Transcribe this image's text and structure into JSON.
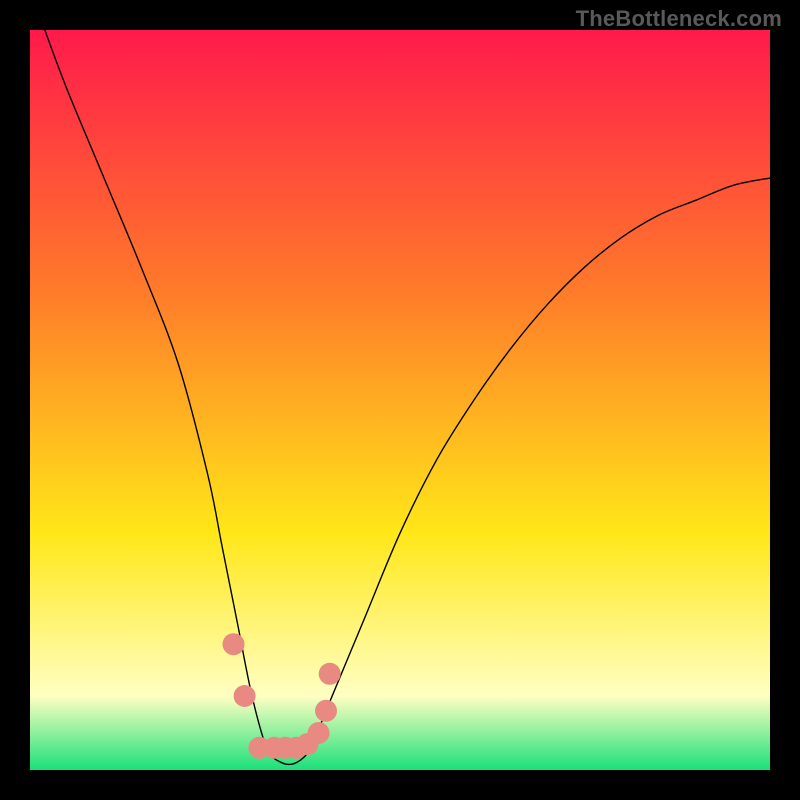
{
  "watermark": "TheBottleneck.com",
  "chart_data": {
    "type": "line",
    "title": "",
    "xlabel": "",
    "ylabel": "",
    "xlim": [
      0,
      100
    ],
    "ylim": [
      0,
      100
    ],
    "background_gradient": {
      "top": "#ff1a4b",
      "mid1": "#ff7a2a",
      "mid2": "#ffe718",
      "low": "#ffffc2",
      "bottom": "#1be07a"
    },
    "series": [
      {
        "name": "bottleneck-curve",
        "style": "black-line",
        "x": [
          2,
          5,
          10,
          15,
          20,
          24,
          26,
          28,
          30,
          32,
          34,
          36,
          38,
          40,
          45,
          50,
          55,
          60,
          65,
          70,
          75,
          80,
          85,
          90,
          95,
          100
        ],
        "values": [
          100,
          92,
          80,
          68,
          55,
          40,
          30,
          20,
          10,
          3,
          1,
          1,
          3,
          8,
          20,
          32,
          42,
          50,
          57,
          63,
          68,
          72,
          75,
          77,
          79,
          80
        ]
      },
      {
        "name": "highlighted-markers",
        "style": "salmon-dots",
        "x": [
          27.5,
          29,
          31,
          33,
          34.5,
          36,
          37.5,
          39,
          40,
          40.5
        ],
        "values": [
          17,
          10,
          3,
          3,
          3,
          3,
          3.5,
          5,
          8,
          13
        ]
      }
    ]
  }
}
